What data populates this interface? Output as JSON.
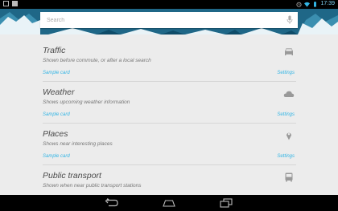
{
  "status_bar": {
    "time": "17:39",
    "left_icons": [
      "gallery-icon",
      "download-icon"
    ],
    "right_icons": [
      "alarm-icon",
      "wifi-icon",
      "battery-icon"
    ]
  },
  "search": {
    "placeholder": "Search",
    "mic_icon": "microphone-icon"
  },
  "cards": [
    {
      "title": "Traffic",
      "description": "Shown before commute, or after a local search",
      "sample": "Sample card",
      "settings": "Settings",
      "icon": "car-icon"
    },
    {
      "title": "Weather",
      "description": "Shows upcoming weather information",
      "sample": "Sample card",
      "settings": "Settings",
      "icon": "cloud-icon"
    },
    {
      "title": "Places",
      "description": "Shows near interesting places",
      "sample": "Sample card",
      "settings": "Settings",
      "icon": "map-pin-icon"
    },
    {
      "title": "Public transport",
      "description": "Shown when near public transport stations",
      "sample": "",
      "settings": "",
      "icon": "bus-icon"
    }
  ],
  "nav_bar": {
    "buttons": [
      "back-icon",
      "home-icon",
      "recent-apps-icon"
    ]
  },
  "colors": {
    "accent": "#33b5e5",
    "background": "#ececec",
    "header": "#2a6f8e",
    "status_bar": "#000000"
  }
}
